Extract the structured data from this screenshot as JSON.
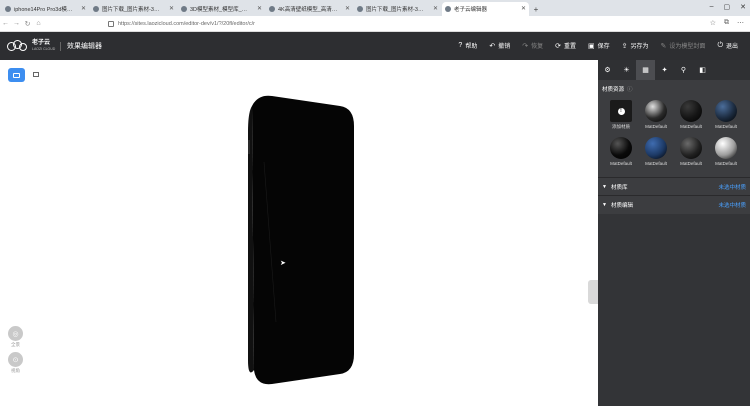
{
  "browser": {
    "tabs": [
      {
        "title": "iphone14Pro Pro3d模型 者…",
        "active": false
      },
      {
        "title": "图片下载_图片素材-3D模型…",
        "active": false
      },
      {
        "title": "3D模型素材_模型库_在线展示…",
        "active": false
      },
      {
        "title": "4K高清壁纸模型_高清壁纸模型…",
        "active": false
      },
      {
        "title": "图片下载_图片素材-3D模型…",
        "active": false
      },
      {
        "title": "老子云编辑器",
        "active": true
      }
    ],
    "url": "https://sites.laozicloud.com/editor-dev/v1/?/20fl/editor/c/r"
  },
  "app": {
    "logo_name": "老子云",
    "logo_sub": "LAOZI CLOUD",
    "title": "效果编辑器",
    "tools": [
      {
        "icon": "?",
        "label": "帮助",
        "enabled": true,
        "name": "help"
      },
      {
        "icon": "↶",
        "label": "撤销",
        "enabled": true,
        "name": "undo"
      },
      {
        "icon": "↷",
        "label": "恢复",
        "enabled": false,
        "name": "redo"
      },
      {
        "icon": "⟳",
        "label": "重置",
        "enabled": true,
        "name": "reset"
      },
      {
        "icon": "▣",
        "label": "保存",
        "enabled": true,
        "name": "save"
      },
      {
        "icon": "⇪",
        "label": "另存为",
        "enabled": true,
        "name": "save-as"
      },
      {
        "icon": "✎",
        "label": "设为模型封面",
        "enabled": false,
        "name": "set-cover"
      },
      {
        "icon": "⏻",
        "label": "退出",
        "enabled": true,
        "name": "exit"
      }
    ]
  },
  "viewport": {
    "fab_1": "全景",
    "fab_2": "视角"
  },
  "panel": {
    "tabs": [
      "⚙",
      "☀",
      "▦",
      "✦",
      "⚲",
      "◧"
    ],
    "active_tab": 2,
    "section_title": "材质资源",
    "materials": [
      {
        "label": "添加材质",
        "kind": "add"
      },
      {
        "label": "MatDefault",
        "kind": "sphere",
        "color": "#2b2b2b",
        "highlight": "#e0e0e0"
      },
      {
        "label": "MatDefault",
        "kind": "sphere",
        "color": "#141414",
        "highlight": "#3a3a3a"
      },
      {
        "label": "MatDefault",
        "kind": "sphere",
        "color": "#1c2b3f",
        "highlight": "#4b6d9a"
      },
      {
        "label": "MatDefault",
        "kind": "sphere",
        "color": "#0a0a0a",
        "highlight": "#555555"
      },
      {
        "label": "MatDefault",
        "kind": "sphere",
        "color": "#1d3a66",
        "highlight": "#3f6cb0"
      },
      {
        "label": "MatDefault",
        "kind": "sphere",
        "color": "#222222",
        "highlight": "#6a6a6a"
      },
      {
        "label": "MatDefault",
        "kind": "sphere",
        "color": "#9d9d9d",
        "highlight": "#ffffff"
      }
    ],
    "accordions": [
      {
        "label": "材质库",
        "action": "未选中材质"
      },
      {
        "label": "材质编辑",
        "action": "未选中材质"
      }
    ]
  }
}
